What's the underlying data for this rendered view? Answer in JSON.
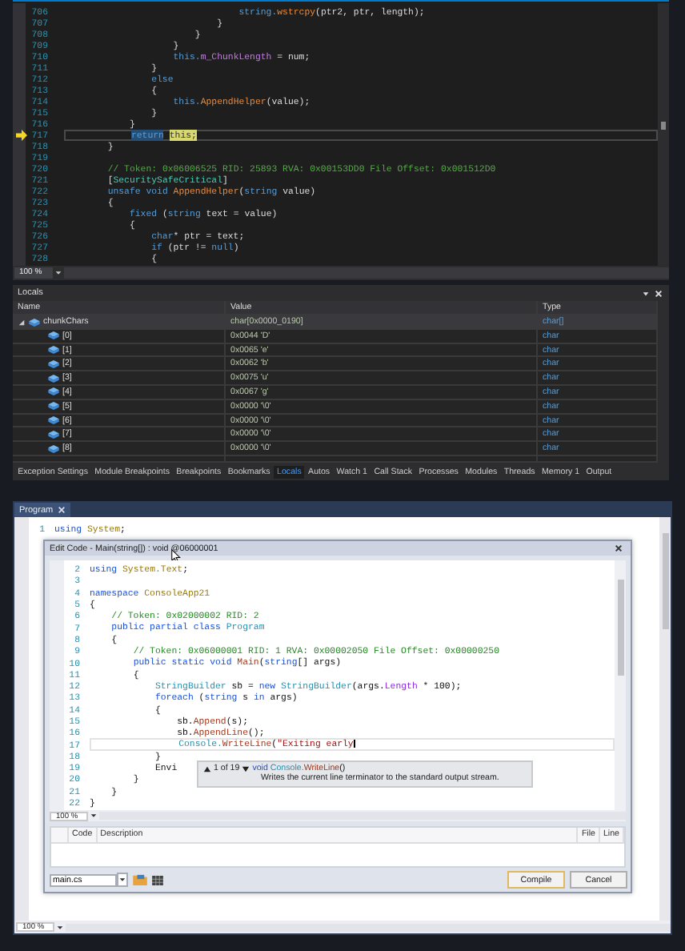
{
  "top_editor": {
    "lines": [
      {
        "number": "706",
        "current": false,
        "tokens": [
          {
            "text": "                                string.",
            "kind": "kw"
          },
          {
            "text": "wstrcpy",
            "kind": "method"
          },
          {
            "text": "(ptr2, ptr, length);",
            "kind": "plain"
          }
        ]
      },
      {
        "number": "707",
        "current": false,
        "tokens": [
          {
            "text": "                            }",
            "kind": "plain"
          }
        ]
      },
      {
        "number": "708",
        "current": false,
        "tokens": [
          {
            "text": "                        }",
            "kind": "plain"
          }
        ]
      },
      {
        "number": "709",
        "current": false,
        "tokens": [
          {
            "text": "                    }",
            "kind": "plain"
          }
        ]
      },
      {
        "number": "710",
        "current": false,
        "tokens": [
          {
            "text": "                    this.",
            "kind": "kw"
          },
          {
            "text": "m_ChunkLength",
            "kind": "field"
          },
          {
            "text": " = num;",
            "kind": "plain"
          }
        ]
      },
      {
        "number": "711",
        "current": false,
        "tokens": [
          {
            "text": "                }",
            "kind": "plain"
          }
        ]
      },
      {
        "number": "712",
        "current": false,
        "tokens": [
          {
            "text": "                else",
            "kind": "kw"
          }
        ]
      },
      {
        "number": "713",
        "current": false,
        "tokens": [
          {
            "text": "                {",
            "kind": "plain"
          }
        ]
      },
      {
        "number": "714",
        "current": false,
        "tokens": [
          {
            "text": "                    this.",
            "kind": "kw"
          },
          {
            "text": "AppendHelper",
            "kind": "method"
          },
          {
            "text": "(value);",
            "kind": "plain"
          }
        ]
      },
      {
        "number": "715",
        "current": false,
        "tokens": [
          {
            "text": "                }",
            "kind": "plain"
          }
        ]
      },
      {
        "number": "716",
        "current": false,
        "tokens": [
          {
            "text": "            }",
            "kind": "plain"
          }
        ]
      },
      {
        "number": "717",
        "current": true,
        "tokens": [
          {
            "text": "            return",
            "kind": "kw",
            "selected": true
          },
          {
            "text": " this;",
            "kind": "kw",
            "highlighted": true
          }
        ]
      },
      {
        "number": "718",
        "current": false,
        "tokens": [
          {
            "text": "        }",
            "kind": "plain"
          }
        ]
      },
      {
        "number": "719",
        "current": false
      },
      {
        "number": "720",
        "current": false,
        "tokens": [
          {
            "text": "        // Token: 0x06006525 RID: 25893 RVA: 0x00153DD0 File Offset: 0x001512D0",
            "kind": "comment"
          }
        ]
      },
      {
        "number": "721",
        "current": false,
        "tokens": [
          {
            "text": "        [",
            "kind": "plain"
          },
          {
            "text": "SecuritySafeCritical",
            "kind": "type"
          },
          {
            "text": "]",
            "kind": "plain"
          }
        ]
      },
      {
        "number": "722",
        "current": false,
        "tokens": [
          {
            "text": "        unsafe void",
            "kind": "kw"
          },
          {
            "text": " AppendHelper",
            "kind": "method"
          },
          {
            "text": "(",
            "kind": "plain"
          },
          {
            "text": "string",
            "kind": "kw"
          },
          {
            "text": " value)",
            "kind": "plain"
          }
        ]
      },
      {
        "number": "723",
        "current": false,
        "tokens": [
          {
            "text": "        {",
            "kind": "plain"
          }
        ]
      },
      {
        "number": "724",
        "current": false,
        "tokens": [
          {
            "text": "            fixed",
            "kind": "kw"
          },
          {
            "text": " (",
            "kind": "plain"
          },
          {
            "text": "string",
            "kind": "kw"
          },
          {
            "text": " text = value)",
            "kind": "plain"
          }
        ]
      },
      {
        "number": "725",
        "current": false,
        "tokens": [
          {
            "text": "            {",
            "kind": "plain"
          }
        ]
      },
      {
        "number": "726",
        "current": false,
        "tokens": [
          {
            "text": "                char",
            "kind": "kw"
          },
          {
            "text": "* ptr = text;",
            "kind": "plain"
          }
        ]
      },
      {
        "number": "727",
        "current": false,
        "tokens": [
          {
            "text": "                if",
            "kind": "kw"
          },
          {
            "text": " (ptr != ",
            "kind": "plain"
          },
          {
            "text": "null",
            "kind": "kw"
          },
          {
            "text": ")",
            "kind": "plain"
          }
        ]
      },
      {
        "number": "728",
        "current": false,
        "tokens": [
          {
            "text": "                {",
            "kind": "plain"
          }
        ]
      }
    ],
    "zoom": "100 %"
  },
  "locals": {
    "title": "Locals",
    "columns": [
      "Name",
      "Value",
      "Type"
    ],
    "rows": [
      {
        "name": "chunkChars",
        "value": "char[0x0000_0190]",
        "type": "char[]",
        "expanded": true,
        "children": [
          {
            "name": "[0]",
            "value": "0x0044 'D'",
            "type": "char"
          },
          {
            "name": "[1]",
            "value": "0x0065 'e'",
            "type": "char"
          },
          {
            "name": "[2]",
            "value": "0x0062 'b'",
            "type": "char"
          },
          {
            "name": "[3]",
            "value": "0x0075 'u'",
            "type": "char"
          },
          {
            "name": "[4]",
            "value": "0x0067 'g'",
            "type": "char"
          },
          {
            "name": "[5]",
            "value": "0x0000 '\\0'",
            "type": "char"
          },
          {
            "name": "[6]",
            "value": "0x0000 '\\0'",
            "type": "char"
          },
          {
            "name": "[7]",
            "value": "0x0000 '\\0'",
            "type": "char"
          },
          {
            "name": "[8]",
            "value": "0x0000 '\\0'",
            "type": "char"
          }
        ]
      }
    ],
    "tabs": [
      {
        "label": "Exception Settings",
        "selected": false
      },
      {
        "label": "Module Breakpoints",
        "selected": false
      },
      {
        "label": "Breakpoints",
        "selected": false
      },
      {
        "label": "Bookmarks",
        "selected": false
      },
      {
        "label": "Locals",
        "selected": true
      },
      {
        "label": "Autos",
        "selected": false
      },
      {
        "label": "Watch 1",
        "selected": false
      },
      {
        "label": "Call Stack",
        "selected": false
      },
      {
        "label": "Processes",
        "selected": false
      },
      {
        "label": "Modules",
        "selected": false
      },
      {
        "label": "Threads",
        "selected": false
      },
      {
        "label": "Memory 1",
        "selected": false
      },
      {
        "label": "Output",
        "selected": false
      }
    ]
  },
  "program_window": {
    "tab": "Program",
    "lines": [
      {
        "number": "1",
        "tokens": [
          {
            "text": "using",
            "kind": "kw"
          },
          {
            "text": " System",
            "kind": "ns"
          },
          {
            "text": ";",
            "kind": "plain"
          }
        ]
      }
    ],
    "zoom": "100 %",
    "edit_code_dialog": {
      "title": "Edit Code - Main(string[]) : void @06000001",
      "lines": [
        {
          "number": "2",
          "caret": false,
          "tokens": [
            {
              "text": "using",
              "kind": "kw"
            },
            {
              "text": " System.",
              "kind": "ns"
            },
            {
              "text": "Text",
              "kind": "ns"
            },
            {
              "text": ";",
              "kind": "plain"
            }
          ]
        },
        {
          "number": "3",
          "caret": false
        },
        {
          "number": "4",
          "caret": false,
          "tokens": [
            {
              "text": "namespace",
              "kind": "kw"
            },
            {
              "text": " ConsoleApp21",
              "kind": "ns"
            }
          ]
        },
        {
          "number": "5",
          "caret": false,
          "tokens": [
            {
              "text": "{",
              "kind": "plain"
            }
          ]
        },
        {
          "number": "6",
          "caret": false,
          "tokens": [
            {
              "text": "    // Token: 0x02000002 RID: 2",
              "kind": "comment"
            }
          ]
        },
        {
          "number": "7",
          "caret": false,
          "tokens": [
            {
              "text": "    public partial class",
              "kind": "kw"
            },
            {
              "text": " Program",
              "kind": "type"
            }
          ]
        },
        {
          "number": "8",
          "caret": false,
          "tokens": [
            {
              "text": "    {",
              "kind": "plain"
            }
          ]
        },
        {
          "number": "9",
          "caret": false,
          "tokens": [
            {
              "text": "        // Token: 0x06000001 RID: 1 RVA: 0x00002050 File Offset: 0x00000250",
              "kind": "comment"
            }
          ]
        },
        {
          "number": "10",
          "caret": false,
          "tokens": [
            {
              "text": "        public static void",
              "kind": "kw"
            },
            {
              "text": " Main",
              "kind": "method"
            },
            {
              "text": "(",
              "kind": "plain"
            },
            {
              "text": "string",
              "kind": "kw"
            },
            {
              "text": "[] args)",
              "kind": "plain"
            }
          ]
        },
        {
          "number": "11",
          "caret": false,
          "tokens": [
            {
              "text": "        {",
              "kind": "plain"
            }
          ]
        },
        {
          "number": "12",
          "caret": false,
          "tokens": [
            {
              "text": "            StringBuilder",
              "kind": "type"
            },
            {
              "text": " sb = ",
              "kind": "plain"
            },
            {
              "text": "new",
              "kind": "kw"
            },
            {
              "text": " StringBuilder",
              "kind": "type"
            },
            {
              "text": "(args.",
              "kind": "plain"
            },
            {
              "text": "Length",
              "kind": "field"
            },
            {
              "text": " * 100);",
              "kind": "plain"
            }
          ]
        },
        {
          "number": "13",
          "caret": false,
          "tokens": [
            {
              "text": "            foreach",
              "kind": "kw"
            },
            {
              "text": " (",
              "kind": "plain"
            },
            {
              "text": "string",
              "kind": "kw"
            },
            {
              "text": " s ",
              "kind": "plain"
            },
            {
              "text": "in",
              "kind": "kw"
            },
            {
              "text": " args)",
              "kind": "plain"
            }
          ]
        },
        {
          "number": "14",
          "caret": false,
          "tokens": [
            {
              "text": "            {",
              "kind": "plain"
            }
          ]
        },
        {
          "number": "15",
          "caret": false,
          "tokens": [
            {
              "text": "                sb.",
              "kind": "plain"
            },
            {
              "text": "Append",
              "kind": "method"
            },
            {
              "text": "(s);",
              "kind": "plain"
            }
          ]
        },
        {
          "number": "16",
          "caret": false,
          "tokens": [
            {
              "text": "                sb.",
              "kind": "plain"
            },
            {
              "text": "AppendLine",
              "kind": "method"
            },
            {
              "text": "();",
              "kind": "plain"
            }
          ]
        },
        {
          "number": "17",
          "caret": true,
          "tokens": [
            {
              "text": "                Console.",
              "kind": "type"
            },
            {
              "text": "WriteLine",
              "kind": "method"
            },
            {
              "text": "(",
              "kind": "plain"
            },
            {
              "text": "\"Exiting early",
              "kind": "str"
            }
          ]
        },
        {
          "number": "18",
          "caret": false,
          "tokens": [
            {
              "text": "            }",
              "kind": "plain"
            }
          ]
        },
        {
          "number": "19",
          "caret": false,
          "tokens": [
            {
              "text": "            Envi",
              "kind": "plain"
            }
          ]
        },
        {
          "number": "20",
          "caret": false,
          "tokens": [
            {
              "text": "        }",
              "kind": "plain"
            }
          ]
        },
        {
          "number": "21",
          "caret": false,
          "tokens": [
            {
              "text": "    }",
              "kind": "plain"
            }
          ]
        },
        {
          "number": "22",
          "caret": false,
          "tokens": [
            {
              "text": "}",
              "kind": "plain"
            }
          ]
        }
      ],
      "tooltip": {
        "counter": "1 of 19",
        "signature": [
          {
            "text": "void",
            "kind": "kw"
          },
          {
            "text": " Console.",
            "kind": "type"
          },
          {
            "text": "WriteLine",
            "kind": "method"
          },
          {
            "text": "()",
            "kind": "plain"
          }
        ],
        "description": "Writes the current line terminator to the standard output stream."
      },
      "zoom": "100 %",
      "error_columns": [
        "Code",
        "Description",
        "File",
        "Line"
      ],
      "file": "main.cs",
      "buttons": [
        {
          "label": "Compile",
          "focused": true
        },
        {
          "label": "Cancel",
          "focused": false
        }
      ]
    }
  }
}
